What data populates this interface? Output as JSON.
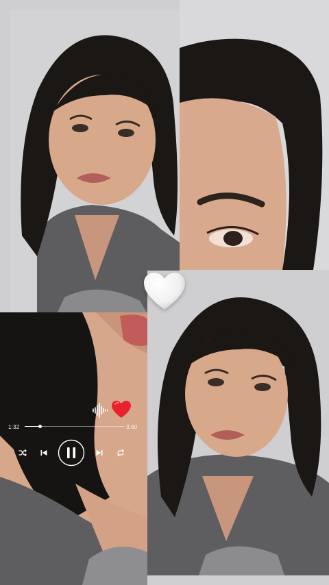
{
  "player": {
    "time_elapsed": "1:32",
    "time_total": "3:60",
    "progress": 0.153
  },
  "icons": {
    "big_heart": "white-heart-icon",
    "like": "red-heart-icon",
    "sound": "sound-wave-icon",
    "shuffle": "shuffle-icon",
    "previous": "skip-previous-icon",
    "pause": "pause-icon",
    "next": "skip-next-icon",
    "repeat": "repeat-icon"
  },
  "colors": {
    "background": "#cfcfd1",
    "heart_red": "#e8232f",
    "heart_white": "#f7f7f7",
    "shirt": "#5e5e60",
    "hair": "#161412",
    "skin": "#d9a98c"
  }
}
